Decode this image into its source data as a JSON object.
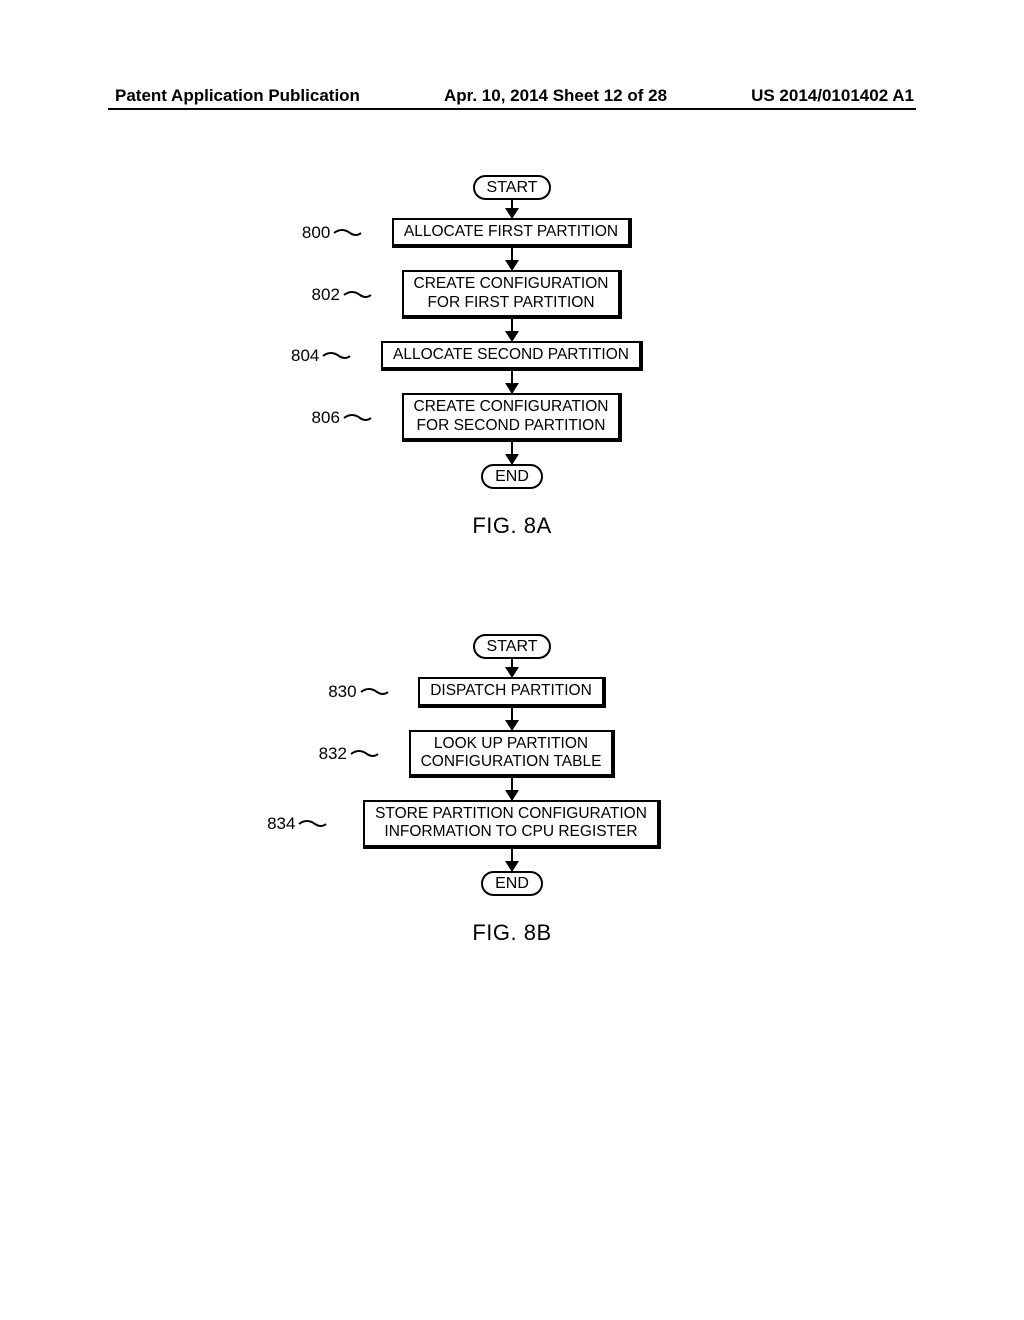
{
  "header": {
    "left": "Patent Application Publication",
    "center": "Apr. 10, 2014  Sheet 12 of 28",
    "right": "US 2014/0101402 A1"
  },
  "figA": {
    "start": "START",
    "end": "END",
    "label": "FIG. 8A",
    "steps": [
      {
        "ref": "800",
        "text": "ALLOCATE FIRST PARTITION"
      },
      {
        "ref": "802",
        "text": "CREATE CONFIGURATION\nFOR FIRST PARTITION"
      },
      {
        "ref": "804",
        "text": "ALLOCATE SECOND PARTITION"
      },
      {
        "ref": "806",
        "text": "CREATE CONFIGURATION\nFOR SECOND PARTITION"
      }
    ]
  },
  "figB": {
    "start": "START",
    "end": "END",
    "label": "FIG. 8B",
    "steps": [
      {
        "ref": "830",
        "text": "DISPATCH PARTITION"
      },
      {
        "ref": "832",
        "text": "LOOK UP PARTITION\nCONFIGURATION TABLE"
      },
      {
        "ref": "834",
        "text": "STORE PARTITION CONFIGURATION\nINFORMATION TO CPU REGISTER"
      }
    ]
  }
}
